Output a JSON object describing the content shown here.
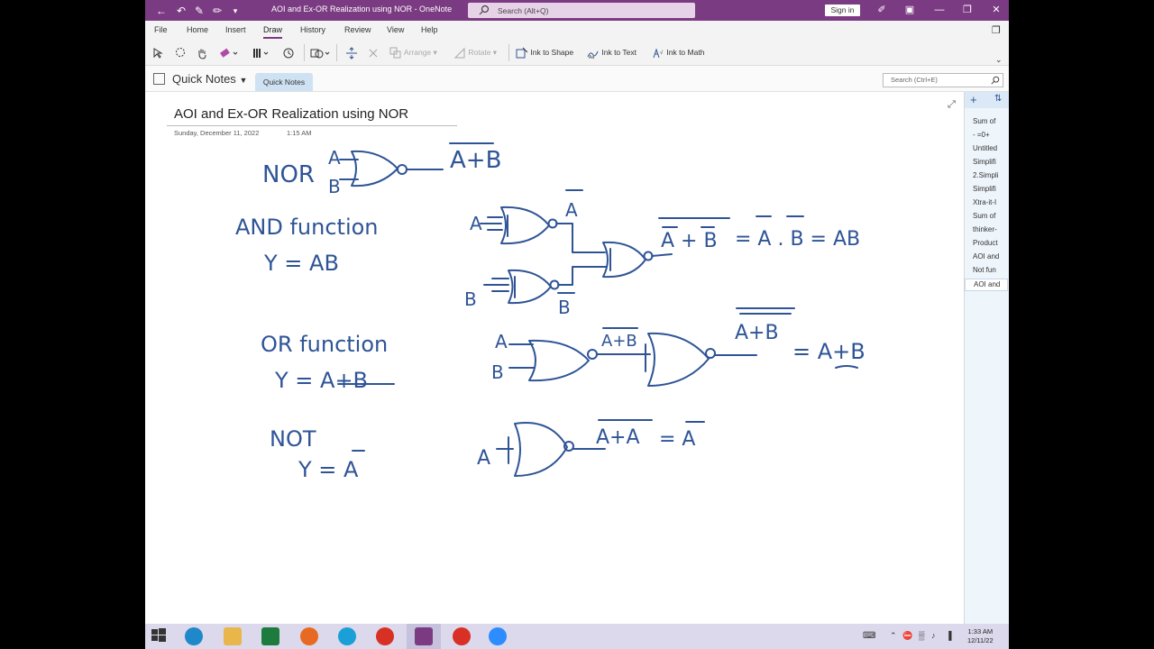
{
  "window": {
    "title": "AOI and Ex-OR Realization using NOR  -  OneNote",
    "search_placeholder": "Search (Alt+Q)",
    "signin_label": "Sign in"
  },
  "menu": {
    "tabs": [
      "File",
      "Home",
      "Insert",
      "Draw",
      "History",
      "Review",
      "View",
      "Help"
    ],
    "active": "Draw"
  },
  "ribbon": {
    "arrange": "Arrange",
    "rotate": "Rotate",
    "ink_to_shape": "Ink to Shape",
    "ink_to_text": "Ink to Text",
    "ink_to_math": "Ink to Math"
  },
  "notebook": {
    "name": "Quick Notes",
    "section": "Quick Notes",
    "search_placeholder": "Search (Ctrl+E)"
  },
  "page": {
    "title": "AOI and Ex-OR Realization using NOR",
    "date": "Sunday, December 11, 2022",
    "time": "1:15 AM"
  },
  "ink": {
    "nor_label": "NOR",
    "in_a": "A",
    "in_b": "B",
    "a_plus_b": "A+B",
    "and_title": "AND function",
    "and_eq": "Y = AB",
    "not_a": "A",
    "not_b": "B",
    "and_result": "A + B",
    "and_eq2": "= A . B = AB",
    "or_title": "OR function",
    "or_eq": "Y = A+B",
    "or_mid": "A+B",
    "or_out": "A+B",
    "or_eq2": "= A+B",
    "not_title": "NOT",
    "not_eq": "Y = A",
    "not_expr": "A+A",
    "not_eq2": "= A"
  },
  "pagelist": [
    "Sum of",
    "-   =0+",
    "Untitled",
    "Simplifi",
    "2.Simpli",
    "Simplifi",
    "Xtra-it-I",
    "Sum of",
    "thinker-",
    "Product",
    "AOI and",
    "Not fun",
    "AOI and"
  ],
  "taskbar": {
    "time": "1:33 AM",
    "date": "12/11/22"
  },
  "colors": {
    "accent": "#7b3b82",
    "ink": "#2f5496",
    "taskbar": "#dcd9ec"
  }
}
